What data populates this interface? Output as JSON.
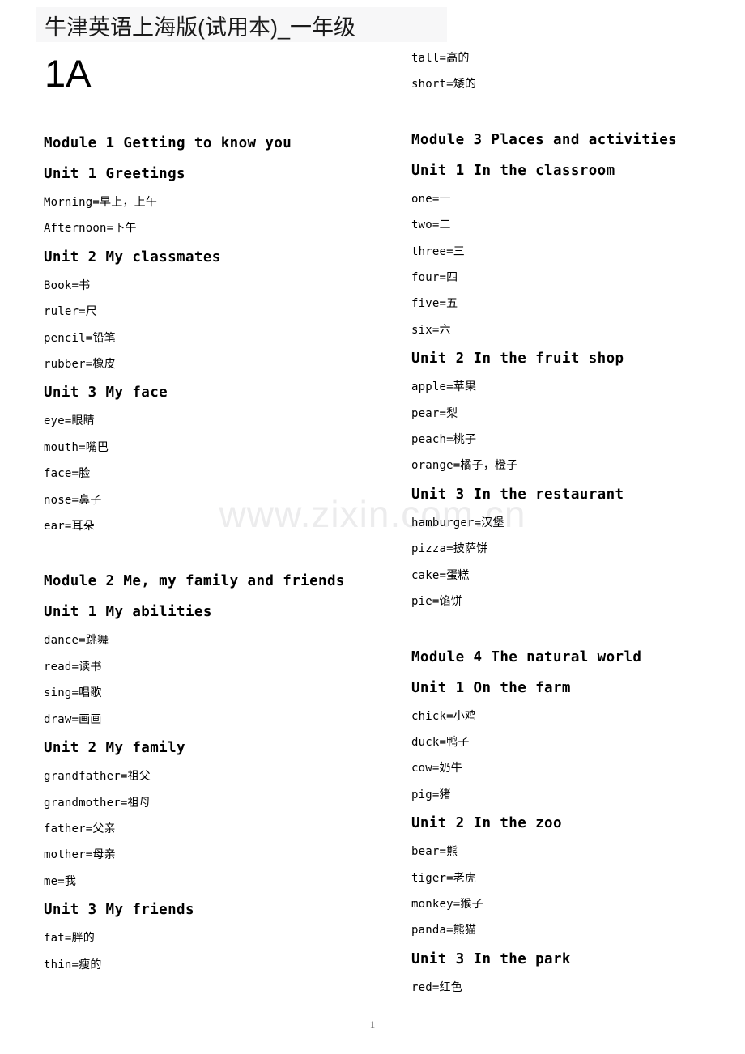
{
  "document": {
    "title": "牛津英语上海版(试用本)_一年级",
    "book_code": "1A",
    "page_number": "1",
    "watermark": "www.zixin.com.cn",
    "title_highlight_color": "#f7f7f8",
    "watermark_color": "#ececed",
    "text_color": "#000000"
  },
  "columns": {
    "left": {
      "blocks": [
        {
          "type": "heading",
          "text": "Module 1 Getting to know you"
        },
        {
          "type": "heading",
          "text": "Unit 1 Greetings"
        },
        {
          "type": "entry",
          "en": "Morning=",
          "cn": "早上，上午"
        },
        {
          "type": "entry",
          "en": "Afternoon=",
          "cn": "下午"
        },
        {
          "type": "heading",
          "text": "Unit 2 My classmates"
        },
        {
          "type": "entry",
          "en": "Book=",
          "cn": "书"
        },
        {
          "type": "entry",
          "en": "ruler=",
          "cn": "尺"
        },
        {
          "type": "entry",
          "en": "pencil=",
          "cn": "铅笔"
        },
        {
          "type": "entry",
          "en": "rubber=",
          "cn": "橡皮"
        },
        {
          "type": "heading",
          "text": "Unit 3 My face"
        },
        {
          "type": "entry",
          "en": "eye=",
          "cn": "眼睛"
        },
        {
          "type": "entry",
          "en": "mouth=",
          "cn": "嘴巴"
        },
        {
          "type": "entry",
          "en": "face=",
          "cn": "脸"
        },
        {
          "type": "entry",
          "en": "nose=",
          "cn": "鼻子"
        },
        {
          "type": "entry",
          "en": "ear=",
          "cn": "耳朵"
        },
        {
          "type": "spacer"
        },
        {
          "type": "heading-justify",
          "text": "Module 2 Me, my family and friends"
        },
        {
          "type": "heading",
          "text": "Unit 1 My abilities"
        },
        {
          "type": "entry",
          "en": "dance=",
          "cn": "跳舞"
        },
        {
          "type": "entry",
          "en": "read=",
          "cn": "读书"
        },
        {
          "type": "entry",
          "en": "sing=",
          "cn": "唱歌"
        },
        {
          "type": "entry",
          "en": "draw=",
          "cn": "画画"
        },
        {
          "type": "heading",
          "text": "Unit 2 My family"
        },
        {
          "type": "entry",
          "en": "grandfather=",
          "cn": "祖父"
        },
        {
          "type": "entry",
          "en": "grandmother=",
          "cn": "祖母"
        },
        {
          "type": "entry",
          "en": "father=",
          "cn": "父亲"
        },
        {
          "type": "entry",
          "en": "mother=",
          "cn": "母亲"
        },
        {
          "type": "entry",
          "en": "me=",
          "cn": "我"
        },
        {
          "type": "heading",
          "text": "Unit 3 My friends"
        },
        {
          "type": "entry",
          "en": "fat=",
          "cn": "胖的"
        },
        {
          "type": "entry",
          "en": "thin=",
          "cn": "瘦的"
        }
      ]
    },
    "right": {
      "blocks": [
        {
          "type": "entry",
          "en": "tall=",
          "cn": "高的"
        },
        {
          "type": "entry",
          "en": "short=",
          "cn": "矮的"
        },
        {
          "type": "spacer"
        },
        {
          "type": "heading",
          "text": "Module 3 Places and activities"
        },
        {
          "type": "heading",
          "text": "Unit 1 In the classroom"
        },
        {
          "type": "entry",
          "en": "one=",
          "cn": "一"
        },
        {
          "type": "entry",
          "en": "two=",
          "cn": "二"
        },
        {
          "type": "entry",
          "en": "three=",
          "cn": "三"
        },
        {
          "type": "entry",
          "en": "four=",
          "cn": "四"
        },
        {
          "type": "entry",
          "en": "five=",
          "cn": "五"
        },
        {
          "type": "entry",
          "en": "six=",
          "cn": "六"
        },
        {
          "type": "heading",
          "text": "Unit 2 In the fruit shop"
        },
        {
          "type": "entry",
          "en": "apple=",
          "cn": "苹果"
        },
        {
          "type": "entry",
          "en": "pear=",
          "cn": "梨"
        },
        {
          "type": "entry",
          "en": "peach=",
          "cn": "桃子"
        },
        {
          "type": "entry",
          "en": "orange=",
          "cn": "橘子，橙子"
        },
        {
          "type": "heading",
          "text": "Unit 3 In the restaurant"
        },
        {
          "type": "entry",
          "en": "hamburger=",
          "cn": "汉堡"
        },
        {
          "type": "entry",
          "en": "pizza=",
          "cn": "披萨饼"
        },
        {
          "type": "entry",
          "en": "cake=",
          "cn": "蛋糕"
        },
        {
          "type": "entry",
          "en": "pie=",
          "cn": "馅饼"
        },
        {
          "type": "spacer"
        },
        {
          "type": "heading",
          "text": "Module 4 The natural world"
        },
        {
          "type": "heading",
          "text": "Unit 1 On the farm"
        },
        {
          "type": "entry",
          "en": "chick=",
          "cn": "小鸡"
        },
        {
          "type": "entry",
          "en": "duck=",
          "cn": "鸭子"
        },
        {
          "type": "entry",
          "en": "cow=",
          "cn": "奶牛"
        },
        {
          "type": "entry",
          "en": "pig=",
          "cn": "猪"
        },
        {
          "type": "heading",
          "text": "Unit 2 In the zoo"
        },
        {
          "type": "entry",
          "en": "bear=",
          "cn": "熊"
        },
        {
          "type": "entry",
          "en": "tiger=",
          "cn": "老虎"
        },
        {
          "type": "entry",
          "en": "monkey=",
          "cn": "猴子"
        },
        {
          "type": "entry",
          "en": "panda=",
          "cn": "熊猫"
        },
        {
          "type": "heading",
          "text": "Unit 3 In the park"
        },
        {
          "type": "entry",
          "en": "red=",
          "cn": "红色"
        }
      ]
    }
  }
}
